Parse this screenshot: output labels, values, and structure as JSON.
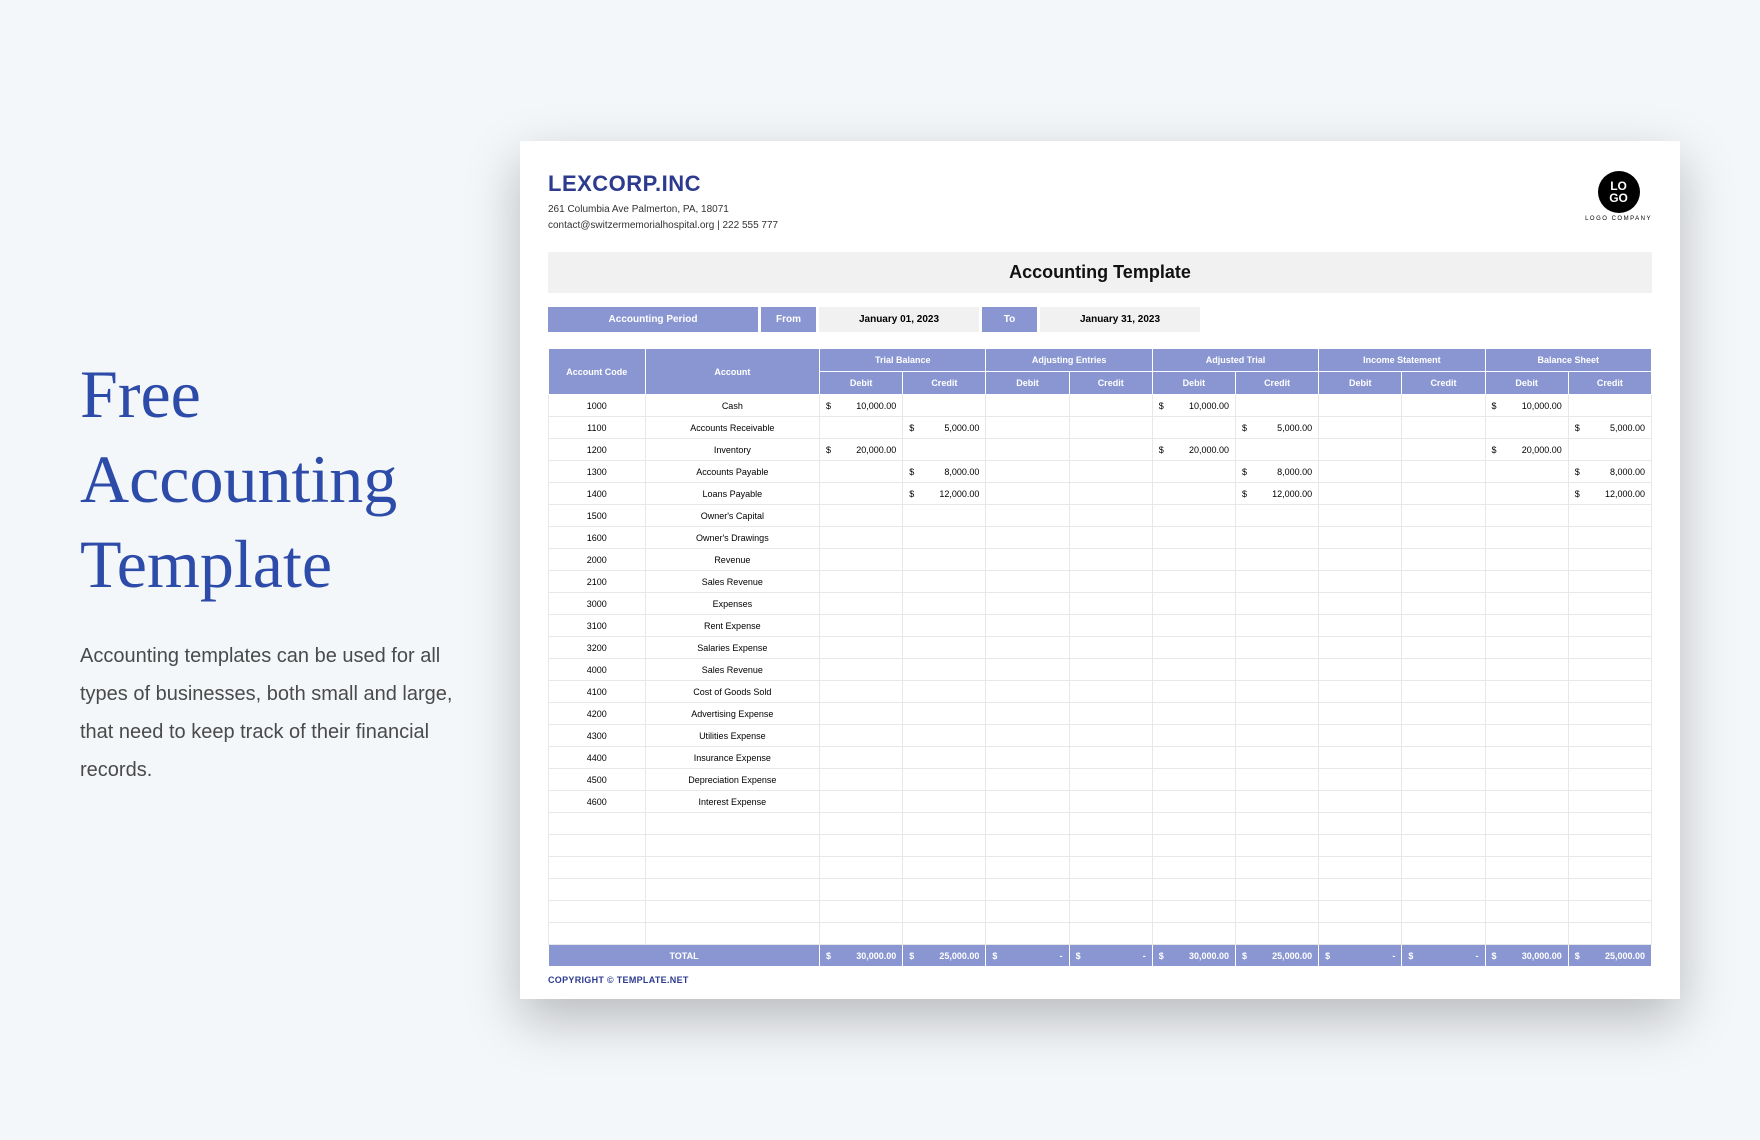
{
  "promo": {
    "title": "Free Accounting Template",
    "description": "Accounting templates can be used for all types of businesses, both small and large, that need to keep track of their financial records."
  },
  "company": {
    "name": "LEXCORP.INC",
    "address": "261 Columbia Ave Palmerton, PA, 18071",
    "contact": "contact@switzermemorialhospital.org | 222 555 777"
  },
  "logo": {
    "text": "LO\nGO",
    "caption": "LOGO COMPANY"
  },
  "doc_title": "Accounting Template",
  "period": {
    "label": "Accounting Period",
    "from_label": "From",
    "from_value": "January 01, 2023",
    "to_label": "To",
    "to_value": "January 31, 2023"
  },
  "headers": {
    "code": "Account Code",
    "account": "Account",
    "groups": [
      "Trial Balance",
      "Adjusting Entries",
      "Adjusted Trial",
      "Income Statement",
      "Balance Sheet"
    ],
    "debit": "Debit",
    "credit": "Credit"
  },
  "rows": [
    {
      "code": "1000",
      "account": "Cash",
      "vals": [
        "10,000.00",
        "",
        "",
        "",
        "10,000.00",
        "",
        "",
        "",
        "10,000.00",
        ""
      ]
    },
    {
      "code": "1100",
      "account": "Accounts Receivable",
      "vals": [
        "",
        "5,000.00",
        "",
        "",
        "",
        "5,000.00",
        "",
        "",
        "",
        "5,000.00"
      ]
    },
    {
      "code": "1200",
      "account": "Inventory",
      "vals": [
        "20,000.00",
        "",
        "",
        "",
        "20,000.00",
        "",
        "",
        "",
        "20,000.00",
        ""
      ]
    },
    {
      "code": "1300",
      "account": "Accounts Payable",
      "vals": [
        "",
        "8,000.00",
        "",
        "",
        "",
        "8,000.00",
        "",
        "",
        "",
        "8,000.00"
      ]
    },
    {
      "code": "1400",
      "account": "Loans Payable",
      "vals": [
        "",
        "12,000.00",
        "",
        "",
        "",
        "12,000.00",
        "",
        "",
        "",
        "12,000.00"
      ]
    },
    {
      "code": "1500",
      "account": "Owner's Capital",
      "vals": [
        "",
        "",
        "",
        "",
        "",
        "",
        "",
        "",
        "",
        ""
      ]
    },
    {
      "code": "1600",
      "account": "Owner's Drawings",
      "vals": [
        "",
        "",
        "",
        "",
        "",
        "",
        "",
        "",
        "",
        ""
      ]
    },
    {
      "code": "2000",
      "account": "Revenue",
      "vals": [
        "",
        "",
        "",
        "",
        "",
        "",
        "",
        "",
        "",
        ""
      ]
    },
    {
      "code": "2100",
      "account": "Sales Revenue",
      "vals": [
        "",
        "",
        "",
        "",
        "",
        "",
        "",
        "",
        "",
        ""
      ]
    },
    {
      "code": "3000",
      "account": "Expenses",
      "vals": [
        "",
        "",
        "",
        "",
        "",
        "",
        "",
        "",
        "",
        ""
      ]
    },
    {
      "code": "3100",
      "account": "Rent Expense",
      "vals": [
        "",
        "",
        "",
        "",
        "",
        "",
        "",
        "",
        "",
        ""
      ]
    },
    {
      "code": "3200",
      "account": "Salaries Expense",
      "vals": [
        "",
        "",
        "",
        "",
        "",
        "",
        "",
        "",
        "",
        ""
      ]
    },
    {
      "code": "4000",
      "account": "Sales Revenue",
      "vals": [
        "",
        "",
        "",
        "",
        "",
        "",
        "",
        "",
        "",
        ""
      ]
    },
    {
      "code": "4100",
      "account": "Cost of Goods Sold",
      "vals": [
        "",
        "",
        "",
        "",
        "",
        "",
        "",
        "",
        "",
        ""
      ]
    },
    {
      "code": "4200",
      "account": "Advertising Expense",
      "vals": [
        "",
        "",
        "",
        "",
        "",
        "",
        "",
        "",
        "",
        ""
      ]
    },
    {
      "code": "4300",
      "account": "Utilities Expense",
      "vals": [
        "",
        "",
        "",
        "",
        "",
        "",
        "",
        "",
        "",
        ""
      ]
    },
    {
      "code": "4400",
      "account": "Insurance Expense",
      "vals": [
        "",
        "",
        "",
        "",
        "",
        "",
        "",
        "",
        "",
        ""
      ]
    },
    {
      "code": "4500",
      "account": "Depreciation Expense",
      "vals": [
        "",
        "",
        "",
        "",
        "",
        "",
        "",
        "",
        "",
        ""
      ]
    },
    {
      "code": "4600",
      "account": "Interest Expense",
      "vals": [
        "",
        "",
        "",
        "",
        "",
        "",
        "",
        "",
        "",
        ""
      ]
    }
  ],
  "blank_rows": 6,
  "totals": {
    "label": "TOTAL",
    "vals": [
      "30,000.00",
      "25,000.00",
      "-",
      "-",
      "30,000.00",
      "25,000.00",
      "-",
      "-",
      "30,000.00",
      "25,000.00"
    ]
  },
  "copyright": "COPYRIGHT © TEMPLATE.NET"
}
